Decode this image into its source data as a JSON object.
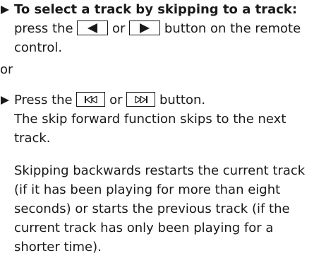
{
  "step1": {
    "bold_lead": "To select a track by skipping to a track:",
    "text_press": "press the",
    "text_or": "or",
    "text_end": "button on the remote control.",
    "key_left_icon": "left-triangle-icon",
    "key_right_icon": "right-triangle-icon"
  },
  "or_separator": "or",
  "step2": {
    "text_press": "Press the",
    "text_or": "or",
    "text_end": "button.",
    "key_prev_icon": "skip-back-icon",
    "key_next_icon": "skip-forward-icon"
  },
  "result1": "The skip forward function skips to the next track.",
  "result2": "Skipping backwards restarts the current track (if it has been playing for more than eight seconds) or starts the previous track (if the current track has only been playing for a shorter time)."
}
